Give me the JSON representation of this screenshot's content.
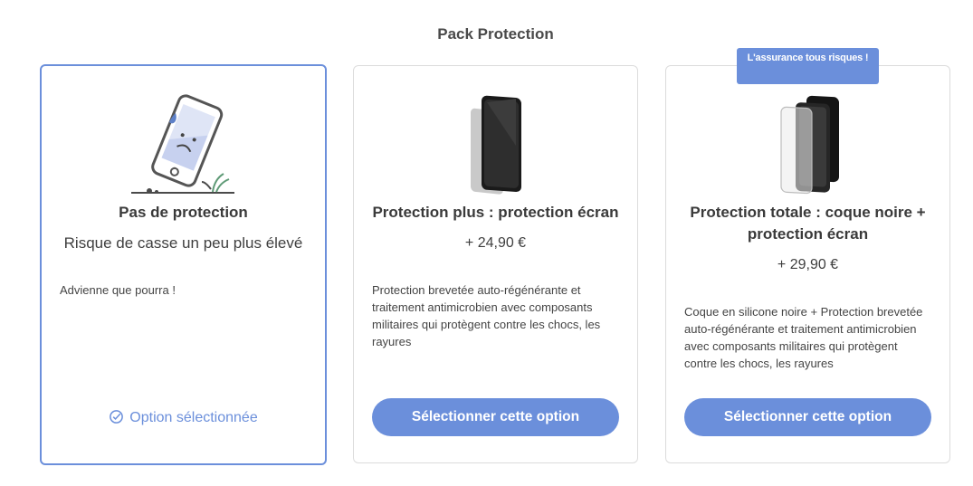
{
  "page": {
    "title": "Pack Protection"
  },
  "colors": {
    "accent": "#6b8fdb",
    "border": "#dcdcdc",
    "text": "#3f3f3f"
  },
  "cards": [
    {
      "illustration": "broken-phone-icon",
      "title": "Pas de protection",
      "subtitle": "Risque de casse un peu plus élevé",
      "description": "Advienne que pourra !",
      "selected_label": "Option sélectionnée",
      "selected": true
    },
    {
      "illustration": "screen-protector-icon",
      "title": "Protection plus : protection écran",
      "price": "+ 24,90 €",
      "description": "Protection brevetée auto-régénérante et traitement antimicrobien avec composants militaires qui protègent contre les chocs, les rayures",
      "button_label": "Sélectionner cette option",
      "selected": false
    },
    {
      "illustration": "case-and-screen-protector-icon",
      "badge": "L'assurance tous risques !",
      "title": "Protection totale : coque noire + protection écran",
      "price": "+ 29,90 €",
      "description": "Coque en silicone noire + Protection brevetée auto-régénérante et traitement antimicrobien avec composants militaires qui protègent contre les chocs, les rayures",
      "button_label": "Sélectionner cette option",
      "selected": false
    }
  ]
}
